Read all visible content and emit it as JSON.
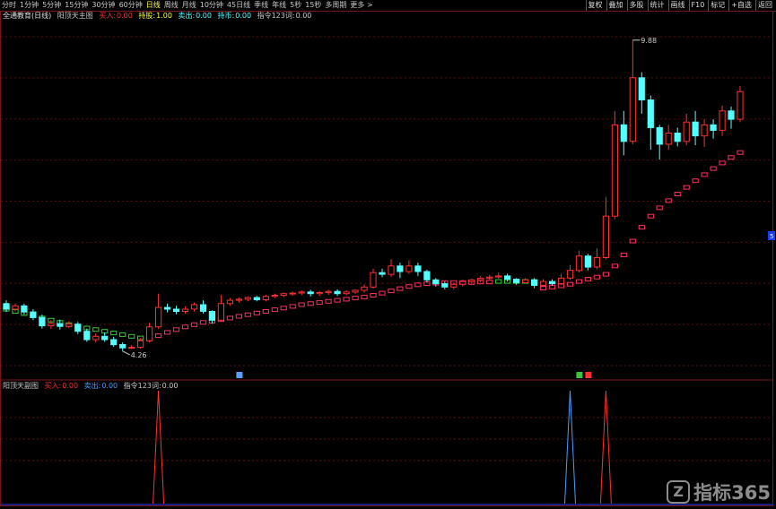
{
  "toolbar": {
    "periods": [
      "分时",
      "1分钟",
      "5分钟",
      "15分钟",
      "30分钟",
      "60分钟",
      "日线",
      "周线",
      "月线",
      "10分钟",
      "45日线",
      "季线",
      "年线",
      "5秒",
      "15秒",
      "多周期",
      "更多 >"
    ],
    "active_period": "日线",
    "right_buttons": [
      "复权",
      "叠加",
      "多股",
      "统计",
      "画线",
      "F10",
      "标记",
      "+自选",
      "返回"
    ]
  },
  "main_legend": {
    "stock": "全通教育(日线)",
    "indicator": "阳顶天主图",
    "buy_label": "买入:",
    "buy_value": "0.00",
    "hold_label": "持股:",
    "hold_value": "1.00",
    "sell_label": "卖出:",
    "sell_value": "0.00",
    "hold2_label": "持币:",
    "hold2_value": "0.00",
    "cmd_label": "指令123词:",
    "cmd_value": "0.00"
  },
  "sub_legend": {
    "indicator": "阳顶天副图",
    "buy_label": "买入:",
    "buy_value": "0.00",
    "sell_label": "卖出:",
    "sell_value": "0.00",
    "cmd_label": "指令123词:",
    "cmd_value": "0.00"
  },
  "annotations": {
    "max_label": "9.88",
    "min_label": "4.26",
    "right_marker": "5"
  },
  "colors": {
    "up": "#ff3030",
    "down": "#54ffff",
    "trail_up": "#ff3060",
    "trail_green": "#30d030",
    "sub_buy": "#ff3030",
    "sub_sell": "#4a9cff",
    "grid": "#5a0c0c"
  },
  "watermark": "指标365",
  "chart_data": [
    {
      "type": "candlestick",
      "title": "全通教育(日线)",
      "ylim": [
        4.0,
        10.2
      ],
      "candles": [
        [
          5.12,
          5.02,
          5.18,
          4.97
        ],
        [
          5.02,
          5.08,
          5.12,
          4.98
        ],
        [
          5.08,
          4.97,
          5.12,
          4.92
        ],
        [
          4.97,
          4.87,
          5.02,
          4.82
        ],
        [
          4.87,
          4.72,
          4.92,
          4.67
        ],
        [
          4.72,
          4.76,
          4.82,
          4.66
        ],
        [
          4.76,
          4.71,
          4.83,
          4.65
        ],
        [
          4.71,
          4.75,
          4.8,
          4.68
        ],
        [
          4.75,
          4.62,
          4.79,
          4.57
        ],
        [
          4.62,
          4.47,
          4.67,
          4.43
        ],
        [
          4.47,
          4.53,
          4.58,
          4.42
        ],
        [
          4.53,
          4.47,
          4.6,
          4.43
        ],
        [
          4.47,
          4.38,
          4.52,
          4.34
        ],
        [
          4.38,
          4.32,
          4.42,
          4.26
        ],
        [
          4.32,
          4.33,
          4.37,
          4.3
        ],
        [
          4.33,
          4.45,
          4.5,
          4.31
        ],
        [
          4.45,
          4.7,
          4.78,
          4.42
        ],
        [
          4.7,
          5.05,
          5.3,
          4.66
        ],
        [
          5.05,
          5.02,
          5.12,
          4.96
        ],
        [
          5.02,
          4.98,
          5.08,
          4.93
        ],
        [
          4.98,
          5.02,
          5.07,
          4.94
        ],
        [
          5.02,
          5.1,
          5.14,
          4.98
        ],
        [
          5.1,
          4.98,
          5.18,
          4.94
        ],
        [
          4.98,
          4.82,
          5.0,
          4.76
        ],
        [
          4.82,
          5.12,
          5.28,
          4.8
        ],
        [
          5.12,
          5.18,
          5.22,
          5.08
        ],
        [
          5.18,
          5.2,
          5.23,
          5.14
        ],
        [
          5.2,
          5.23,
          5.25,
          5.16
        ],
        [
          5.23,
          5.19,
          5.26,
          5.16
        ],
        [
          5.19,
          5.25,
          5.28,
          5.16
        ],
        [
          5.25,
          5.27,
          5.3,
          5.22
        ],
        [
          5.27,
          5.3,
          5.32,
          5.24
        ],
        [
          5.3,
          5.31,
          5.34,
          5.26
        ],
        [
          5.31,
          5.33,
          5.36,
          5.27
        ],
        [
          5.33,
          5.3,
          5.37,
          5.25
        ],
        [
          5.3,
          5.32,
          5.35,
          5.26
        ],
        [
          5.32,
          5.34,
          5.37,
          5.28
        ],
        [
          5.34,
          5.3,
          5.38,
          5.26
        ],
        [
          5.3,
          5.33,
          5.36,
          5.27
        ],
        [
          5.33,
          5.36,
          5.38,
          5.3
        ],
        [
          5.36,
          5.42,
          5.46,
          5.32
        ],
        [
          5.42,
          5.68,
          5.75,
          5.39
        ],
        [
          5.68,
          5.65,
          5.75,
          5.6
        ],
        [
          5.65,
          5.8,
          5.92,
          5.6
        ],
        [
          5.8,
          5.7,
          5.86,
          5.58
        ],
        [
          5.7,
          5.8,
          5.9,
          5.66
        ],
        [
          5.8,
          5.7,
          5.86,
          5.62
        ],
        [
          5.7,
          5.55,
          5.73,
          5.5
        ],
        [
          5.55,
          5.48,
          5.58,
          5.43
        ],
        [
          5.48,
          5.42,
          5.52,
          5.38
        ],
        [
          5.42,
          5.47,
          5.5,
          5.38
        ],
        [
          5.47,
          5.52,
          5.55,
          5.43
        ],
        [
          5.52,
          5.55,
          5.57,
          5.48
        ],
        [
          5.55,
          5.58,
          5.62,
          5.5
        ],
        [
          5.58,
          5.6,
          5.64,
          5.53
        ],
        [
          5.6,
          5.62,
          5.68,
          5.57
        ],
        [
          5.62,
          5.56,
          5.66,
          5.52
        ],
        [
          5.56,
          5.5,
          5.58,
          5.46
        ],
        [
          5.5,
          5.55,
          5.58,
          5.48
        ],
        [
          5.55,
          5.45,
          5.58,
          5.4
        ],
        [
          5.45,
          5.52,
          5.56,
          5.42
        ],
        [
          5.52,
          5.48,
          5.56,
          5.44
        ],
        [
          5.48,
          5.58,
          5.66,
          5.45
        ],
        [
          5.58,
          5.72,
          5.82,
          5.55
        ],
        [
          5.72,
          5.98,
          6.08,
          5.68
        ],
        [
          5.98,
          5.78,
          6.02,
          5.72
        ],
        [
          5.78,
          5.95,
          6.12,
          5.74
        ],
        [
          5.95,
          6.7,
          7.05,
          5.92
        ],
        [
          6.7,
          8.35,
          8.6,
          6.65
        ],
        [
          8.35,
          8.05,
          8.6,
          7.8
        ],
        [
          8.05,
          9.2,
          9.88,
          8.0
        ],
        [
          9.2,
          8.8,
          9.3,
          8.55
        ],
        [
          8.8,
          8.3,
          8.88,
          7.9
        ],
        [
          8.3,
          8.0,
          8.35,
          7.72
        ],
        [
          8.0,
          8.2,
          8.35,
          7.9
        ],
        [
          8.2,
          8.05,
          8.3,
          7.96
        ],
        [
          8.05,
          8.4,
          8.55,
          7.98
        ],
        [
          8.4,
          8.15,
          8.6,
          7.98
        ],
        [
          8.15,
          8.35,
          8.45,
          7.95
        ],
        [
          8.35,
          8.25,
          8.45,
          8.1
        ],
        [
          8.25,
          8.6,
          8.7,
          8.15
        ],
        [
          8.6,
          8.45,
          8.68,
          8.28
        ],
        [
          8.45,
          8.95,
          9.05,
          8.4
        ]
      ],
      "trail": [
        [
          5.02,
          "green"
        ],
        [
          4.98,
          "green"
        ],
        [
          4.94,
          "green"
        ],
        [
          4.9,
          "green"
        ],
        [
          4.86,
          "green"
        ],
        [
          4.82,
          "green"
        ],
        [
          4.78,
          "green"
        ],
        [
          4.74,
          "green"
        ],
        [
          4.71,
          "green"
        ],
        [
          4.68,
          "green"
        ],
        [
          4.65,
          "green"
        ],
        [
          4.62,
          "green"
        ],
        [
          4.59,
          "green"
        ],
        [
          4.56,
          "green"
        ],
        [
          4.53,
          "green"
        ],
        [
          4.5,
          "green"
        ],
        [
          4.48,
          "red"
        ],
        [
          4.54,
          "red"
        ],
        [
          4.6,
          "red"
        ],
        [
          4.65,
          "red"
        ],
        [
          4.7,
          "red"
        ],
        [
          4.74,
          "red"
        ],
        [
          4.78,
          "red"
        ],
        [
          4.8,
          "red"
        ],
        [
          4.83,
          "red"
        ],
        [
          4.86,
          "red"
        ],
        [
          4.89,
          "red"
        ],
        [
          4.92,
          "red"
        ],
        [
          4.95,
          "red"
        ],
        [
          4.98,
          "red"
        ],
        [
          5.01,
          "red"
        ],
        [
          5.04,
          "red"
        ],
        [
          5.07,
          "red"
        ],
        [
          5.1,
          "red"
        ],
        [
          5.12,
          "red"
        ],
        [
          5.14,
          "red"
        ],
        [
          5.16,
          "red"
        ],
        [
          5.18,
          "red"
        ],
        [
          5.2,
          "red"
        ],
        [
          5.22,
          "red"
        ],
        [
          5.24,
          "red"
        ],
        [
          5.27,
          "red"
        ],
        [
          5.31,
          "red"
        ],
        [
          5.35,
          "red"
        ],
        [
          5.39,
          "red"
        ],
        [
          5.43,
          "red"
        ],
        [
          5.46,
          "red"
        ],
        [
          5.48,
          "red"
        ],
        [
          5.49,
          "red"
        ],
        [
          5.5,
          "red"
        ],
        [
          5.5,
          "red"
        ],
        [
          5.5,
          "red"
        ],
        [
          5.5,
          "red"
        ],
        [
          5.51,
          "red"
        ],
        [
          5.51,
          "red"
        ],
        [
          5.52,
          "green"
        ],
        [
          5.52,
          "green"
        ],
        [
          5.52,
          "green"
        ],
        [
          5.52,
          "green"
        ],
        [
          5.52,
          "green"
        ],
        [
          5.4,
          "red"
        ],
        [
          5.42,
          "red"
        ],
        [
          5.44,
          "red"
        ],
        [
          5.47,
          "red"
        ],
        [
          5.52,
          "red"
        ],
        [
          5.56,
          "red"
        ],
        [
          5.6,
          "red"
        ],
        [
          5.65,
          "red"
        ],
        [
          5.8,
          "red"
        ],
        [
          6.0,
          "red"
        ],
        [
          6.25,
          "red"
        ],
        [
          6.5,
          "red"
        ],
        [
          6.7,
          "red"
        ],
        [
          6.85,
          "red"
        ],
        [
          6.98,
          "red"
        ],
        [
          7.1,
          "red"
        ],
        [
          7.22,
          "red"
        ],
        [
          7.34,
          "red"
        ],
        [
          7.45,
          "red"
        ],
        [
          7.56,
          "red"
        ],
        [
          7.66,
          "red"
        ],
        [
          7.76,
          "red"
        ],
        [
          7.85,
          "red"
        ]
      ],
      "bottom_markers": [
        {
          "index": 26,
          "label": "■",
          "color": "#54a0ff"
        },
        {
          "index": 64,
          "label": "■",
          "color": "#3fbf3f"
        },
        {
          "index": 65,
          "label": "■",
          "color": "#ff3030"
        }
      ]
    },
    {
      "type": "line",
      "title": "阳顶天副图",
      "ylim": [
        0,
        1
      ],
      "series": [
        {
          "name": "买入",
          "color": "#ff3030",
          "spikes": [
            17,
            67
          ]
        },
        {
          "name": "卖出",
          "color": "#4a9cff",
          "spikes": [
            63
          ]
        }
      ]
    }
  ]
}
